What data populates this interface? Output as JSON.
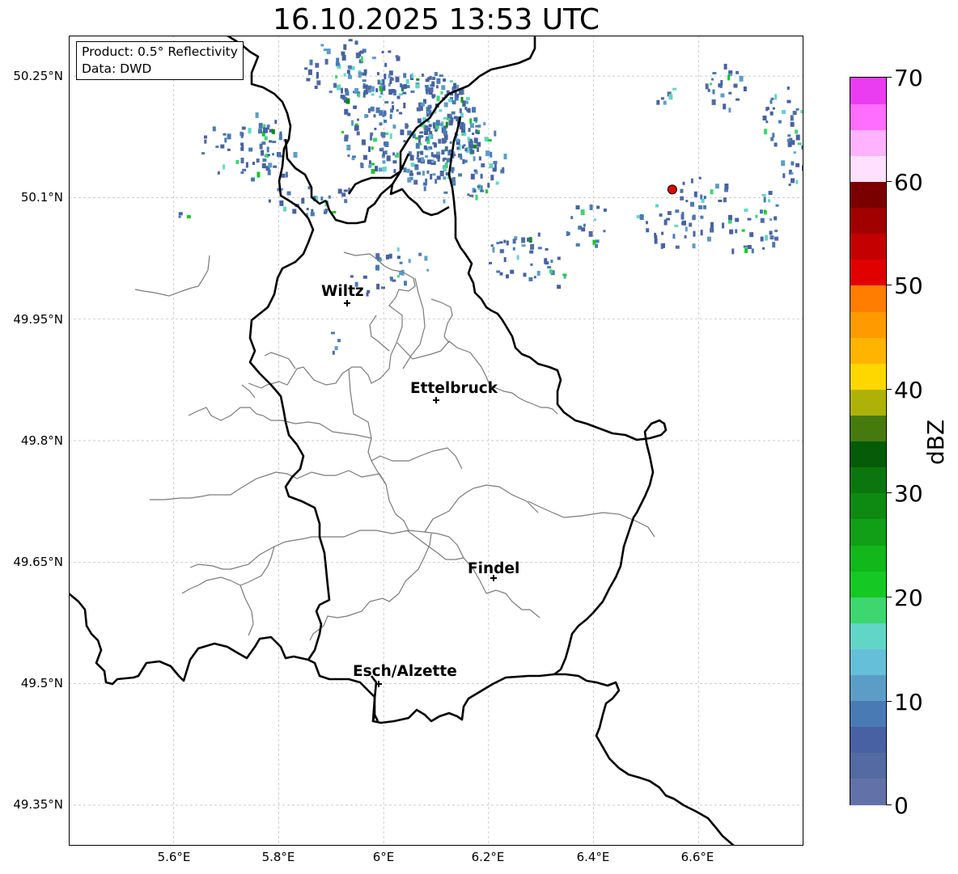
{
  "title": "16.10.2025 13:53 UTC",
  "info": {
    "product": "Product: 0.5° Reflectivity",
    "data": "Data: DWD"
  },
  "axes": {
    "lat_labels": [
      "50.25°N",
      "50.1°N",
      "49.95°N",
      "49.8°N",
      "49.65°N",
      "49.5°N",
      "49.35°N"
    ],
    "lon_labels": [
      "5.6°E",
      "5.8°E",
      "6°E",
      "6.2°E",
      "6.4°E",
      "6.6°E"
    ],
    "lat_range": [
      49.3,
      50.3
    ],
    "lon_range": [
      5.4,
      6.8
    ],
    "grid": true
  },
  "cities": [
    {
      "name": "Wiltz",
      "lon": 5.93,
      "lat": 49.97
    },
    {
      "name": "Ettelbruck",
      "lon": 6.1,
      "lat": 49.85
    },
    {
      "name": "Findel",
      "lon": 6.21,
      "lat": 49.63
    },
    {
      "name": "Esch/Alzette",
      "lon": 5.99,
      "lat": 49.5
    }
  ],
  "radar_site": {
    "lon": 6.55,
    "lat": 50.11,
    "color": "#e00000"
  },
  "colorbar": {
    "label": "dBZ",
    "ticks": [
      "0",
      "10",
      "20",
      "30",
      "40",
      "50",
      "60",
      "70"
    ],
    "min": 0,
    "max": 70,
    "colors": [
      "#6272a8",
      "#536aa3",
      "#4761a2",
      "#4a7ab3",
      "#5c9dc8",
      "#66bfd9",
      "#62d6c6",
      "#3dd66f",
      "#15c823",
      "#12b71c",
      "#109f16",
      "#0e8a12",
      "#0c760e",
      "#055b08",
      "#477a0d",
      "#aeb208",
      "#ffd700",
      "#ffb400",
      "#ff9b00",
      "#ff7d00",
      "#e10000",
      "#c40000",
      "#a00000",
      "#7a0000",
      "#ffe0ff",
      "#ffb3ff",
      "#ff6eff",
      "#ea3df2"
    ]
  }
}
